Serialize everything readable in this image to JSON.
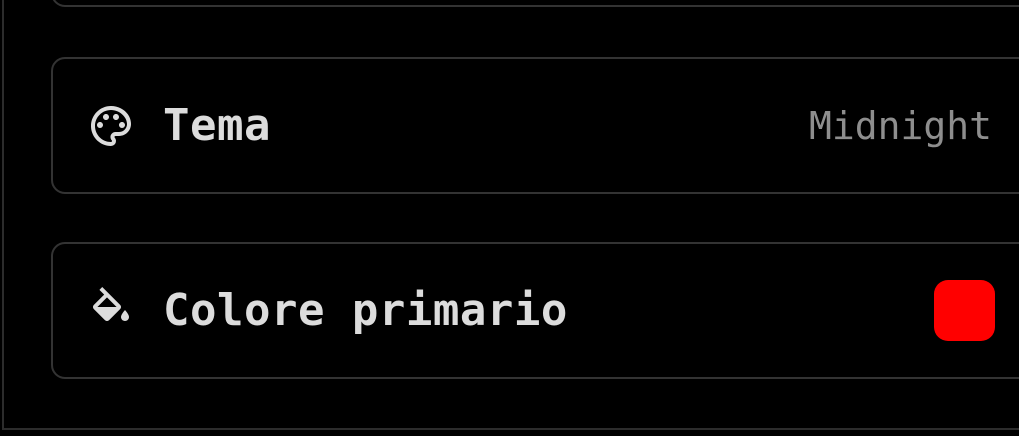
{
  "settings": {
    "theme": {
      "label": "Tema",
      "value": "Midnight",
      "icon": "palette-icon"
    },
    "primary_color": {
      "label": "Colore primario",
      "value_color": "#ff0000",
      "icon": "paint-bucket-icon"
    }
  },
  "colors": {
    "background": "#000000",
    "card_border": "#333333",
    "label_text": "#dcdcdc",
    "value_text": "#8e8e8e",
    "accent": "#ff0000"
  }
}
